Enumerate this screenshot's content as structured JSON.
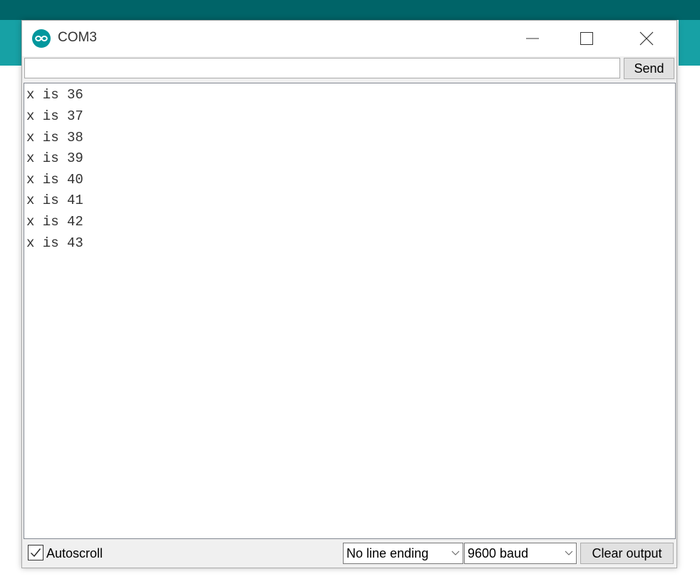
{
  "window": {
    "title": "COM3",
    "accent_color": "#00979d",
    "header_color": "#006468"
  },
  "send_bar": {
    "input_value": "",
    "send_label": "Send"
  },
  "output": {
    "lines": [
      "x is 36",
      "x is 37",
      "x is 38",
      "x is 39",
      "x is 40",
      "x is 41",
      "x is 42",
      "x is 43"
    ]
  },
  "footer": {
    "autoscroll_label": "Autoscroll",
    "autoscroll_checked": true,
    "line_ending": "No line ending",
    "baud_rate": "9600 baud",
    "clear_label": "Clear output"
  },
  "icons": {
    "app": "arduino-icon",
    "minimize": "minimize-icon",
    "maximize": "maximize-icon",
    "close": "close-icon",
    "checkbox": "check-icon",
    "dropdown": "chevron-down-icon"
  }
}
